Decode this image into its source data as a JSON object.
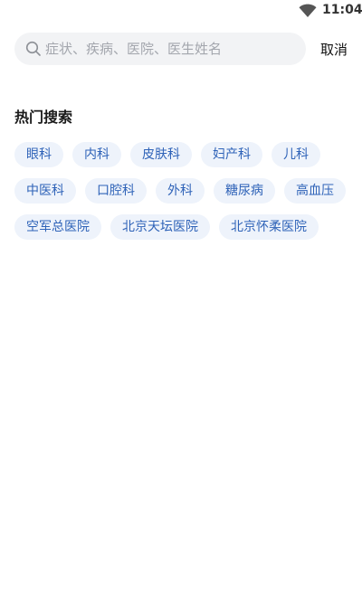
{
  "status_bar": {
    "time": "11:04",
    "wifi_icon": "wifi-icon"
  },
  "search": {
    "placeholder": "症状、疾病、医院、医生姓名",
    "value": "",
    "icon": "search-icon",
    "cancel_label": "取消"
  },
  "hot_search": {
    "title": "热门搜索",
    "tags": [
      "眼科",
      "内科",
      "皮肤科",
      "妇产科",
      "儿科",
      "中医科",
      "口腔科",
      "外科",
      "糖尿病",
      "高血压",
      "空军总医院",
      "北京天坛医院",
      "北京怀柔医院"
    ]
  },
  "colors": {
    "tag_background": "#eef3fb",
    "tag_text": "#2f63b8",
    "search_background": "#f2f3f5"
  }
}
